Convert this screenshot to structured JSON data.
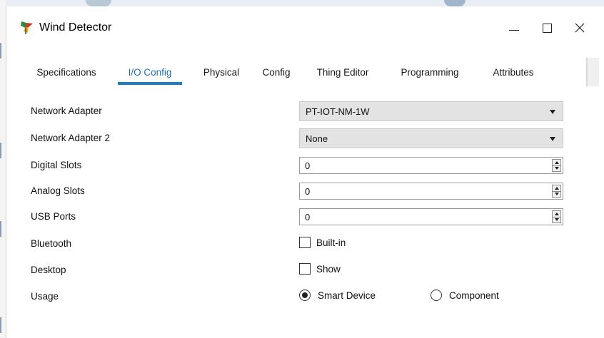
{
  "window": {
    "title": "Wind Detector",
    "icon": "wind-detector-icon",
    "controls": [
      "minimize",
      "maximize",
      "close"
    ]
  },
  "tabs": [
    {
      "label": "Specifications",
      "active": false
    },
    {
      "label": "I/O Config",
      "active": true
    },
    {
      "label": "Physical",
      "active": false
    },
    {
      "label": "Config",
      "active": false
    },
    {
      "label": "Thing Editor",
      "active": false
    },
    {
      "label": "Programming",
      "active": false
    },
    {
      "label": "Attributes",
      "active": false
    }
  ],
  "fields": {
    "network_adapter": {
      "label": "Network Adapter",
      "value": "PT-IOT-NM-1W"
    },
    "network_adapter_2": {
      "label": "Network Adapter 2",
      "value": "None"
    },
    "digital_slots": {
      "label": "Digital Slots",
      "value": "0"
    },
    "analog_slots": {
      "label": "Analog Slots",
      "value": "0"
    },
    "usb_ports": {
      "label": "USB Ports",
      "value": "0"
    },
    "bluetooth": {
      "label": "Bluetooth",
      "option": "Built-in",
      "checked": false
    },
    "desktop": {
      "label": "Desktop",
      "option": "Show",
      "checked": false
    },
    "usage": {
      "label": "Usage",
      "options": [
        {
          "label": "Smart Device",
          "selected": true
        },
        {
          "label": "Component",
          "selected": false
        }
      ]
    }
  },
  "colors": {
    "active_tab": "#1d6fb8",
    "tab_underline": "#1d7ec8",
    "panel_bg": "#ffffff",
    "select_bg": "#e3e3e3"
  }
}
